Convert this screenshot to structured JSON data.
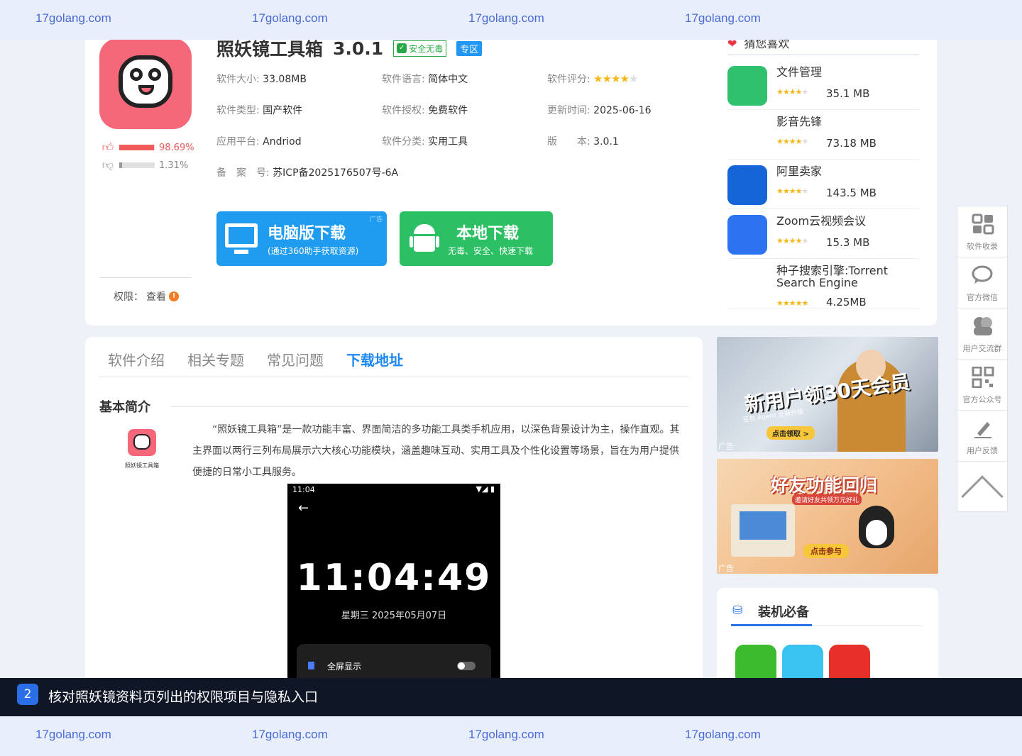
{
  "watermark": {
    "text": "17golang.com"
  },
  "app": {
    "name": "照妖镜工具箱",
    "version": "3.0.1",
    "badge_safe": "安全无毒",
    "badge_zone": "专区",
    "meta": {
      "size_k": "软件大小:",
      "size_v": "33.08MB",
      "lang_k": "软件语言:",
      "lang_v": "简体中文",
      "rating_k": "软件评分:",
      "rating": 4,
      "type_k": "软件类型:",
      "type_v": "国产软件",
      "license_k": "软件授权:",
      "license_v": "免费软件",
      "updated_k": "更新时间:",
      "updated_v": "2025-06-16",
      "platform_k": "应用平台:",
      "platform_v": "Andriod",
      "category_k": "软件分类:",
      "category_v": "实用工具",
      "version_k": "版　　本:",
      "version_v": "3.0.1",
      "icp_k": "备　案　号:",
      "icp_v": "苏ICP备2025176507号-6A"
    },
    "votes": {
      "up": "98.69%",
      "up_fraction": 0.9869,
      "down": "1.31%",
      "down_fraction": 0.0131
    },
    "permission_label": "权限：",
    "permission_link": "查看"
  },
  "download": {
    "pc_title": "电脑版下载",
    "pc_sub": "(通过360助手获取资源)",
    "pc_ad": "广告",
    "local_title": "本地下载",
    "local_sub": "无毒、安全、快速下载"
  },
  "guess": {
    "title": "猜您喜欢",
    "items": [
      {
        "name": "文件管理",
        "size": "35.1 MB",
        "color": "#2fc16e"
      },
      {
        "name": "影音先锋",
        "size": "73.18 MB",
        "color": "#ffffff"
      },
      {
        "name": "阿里卖家",
        "size": "143.5 MB",
        "color": "#1565d8"
      },
      {
        "name": "Zoom云视频会议",
        "size": "15.3 MB",
        "color": "#2d72f0"
      },
      {
        "name": "种子搜索引擎:Torrent Search Engine",
        "size": "4.25MB",
        "color": "#ffffff"
      }
    ]
  },
  "tabs": [
    "软件介绍",
    "相关专题",
    "常见问题",
    "下载地址"
  ],
  "active_tab": "下载地址",
  "intro": {
    "section_title": "基本简介",
    "icon_label": "照妖镜工具箱",
    "text": "“照妖镜工具箱”是一款功能丰富、界面简洁的多功能工具类手机应用，以深色背景设计为主，操作直观。其主界面以两行三列布局展示六大核心功能模块，涵盖趣味互动、实用工具及个性化设置等场景，旨在为用户提供便捷的日常小工具服务。"
  },
  "screenshot": {
    "status_time": "11:04",
    "status_icons": "▼◢ ▮",
    "clock": "11:04:49",
    "date": "星期三 2025年05月07日",
    "toggle_label": "全屏显示"
  },
  "ads": {
    "ad1_title": "新用户领30天会员",
    "ad1_sub": "豆包 Agent 全新升级",
    "ad1_cta": "点击领取 >",
    "ad1_label": "广告",
    "ad2_title": "好友功能回归",
    "ad2_sub": "邀请好友共领万元好礼",
    "ad2_cta": "点击参与",
    "ad2_label": "广告"
  },
  "must_have": {
    "title": "装机必备",
    "apps": [
      {
        "icon": "360-guard-icon",
        "color": "#3cbb2e"
      },
      {
        "icon": "flower-app-icon",
        "color": "#3ac3f0"
      },
      {
        "icon": "driver-app-icon",
        "color": "#e8302a"
      },
      {
        "icon": "baidu-netdisk-icon",
        "color": "#ffffff"
      }
    ]
  },
  "sidebar": [
    "软件收录",
    "官方微信",
    "用户交流群",
    "官方公众号",
    "用户反馈"
  ],
  "instruction": {
    "step": "2",
    "text": "核对照妖镜资料页列出的权限项目与隐私入口"
  }
}
